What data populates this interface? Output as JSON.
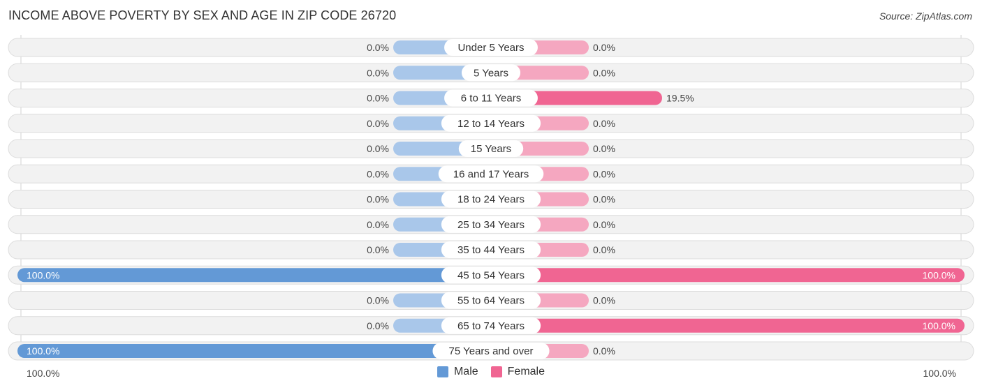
{
  "header": {
    "title": "INCOME ABOVE POVERTY BY SEX AND AGE IN ZIP CODE 26720",
    "source": "Source: ZipAtlas.com"
  },
  "colors": {
    "male_full": "#6399d6",
    "male_light": "#a9c7ea",
    "female_full": "#f06592",
    "female_light": "#f5a7c0",
    "track": "#f2f2f2"
  },
  "chart_data": {
    "type": "bar",
    "orientation": "horizontal-diverging",
    "title": "INCOME ABOVE POVERTY BY SEX AND AGE IN ZIP CODE 26720",
    "categories": [
      "Under 5 Years",
      "5 Years",
      "6 to 11 Years",
      "12 to 14 Years",
      "15 Years",
      "16 and 17 Years",
      "18 to 24 Years",
      "25 to 34 Years",
      "35 to 44 Years",
      "45 to 54 Years",
      "55 to 64 Years",
      "65 to 74 Years",
      "75 Years and over"
    ],
    "series": [
      {
        "name": "Male",
        "values": [
          0.0,
          0.0,
          0.0,
          0.0,
          0.0,
          0.0,
          0.0,
          0.0,
          0.0,
          100.0,
          0.0,
          0.0,
          100.0
        ],
        "labels": [
          "0.0%",
          "0.0%",
          "0.0%",
          "0.0%",
          "0.0%",
          "0.0%",
          "0.0%",
          "0.0%",
          "0.0%",
          "100.0%",
          "0.0%",
          "0.0%",
          "100.0%"
        ]
      },
      {
        "name": "Female",
        "values": [
          0.0,
          0.0,
          19.5,
          0.0,
          0.0,
          0.0,
          0.0,
          0.0,
          0.0,
          100.0,
          0.0,
          100.0,
          0.0
        ],
        "labels": [
          "0.0%",
          "0.0%",
          "19.5%",
          "0.0%",
          "0.0%",
          "0.0%",
          "0.0%",
          "0.0%",
          "0.0%",
          "100.0%",
          "0.0%",
          "100.0%",
          "0.0%"
        ]
      }
    ],
    "xlim": [
      -100,
      100
    ],
    "axis_labels": {
      "left": "100.0%",
      "right": "100.0%"
    },
    "legend": {
      "position": "bottom-center",
      "entries": [
        "Male",
        "Female"
      ]
    }
  }
}
